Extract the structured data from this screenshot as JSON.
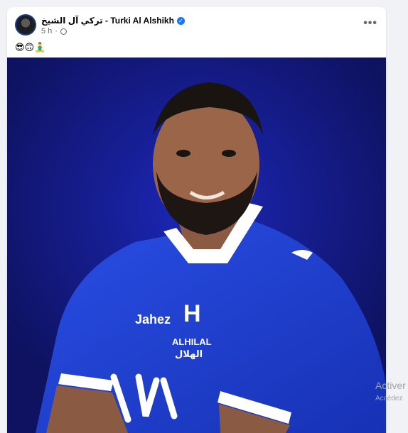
{
  "post": {
    "author_name": "تركي آل الشيخ - Turki Al Alshikh",
    "timestamp": "5 h",
    "caption": "😎🙃🧘‍♂️",
    "more_label": "•••"
  },
  "icons": {
    "verified": "verified-badge-icon",
    "audience": "globe-icon",
    "more": "more-options-icon"
  },
  "photo": {
    "jersey_brand": "Jahez",
    "club_name_en": "ALHILAL",
    "club_name_ar": "الهلال",
    "club_colors": {
      "blue": "#1f3fd6",
      "white": "#ffffff"
    }
  },
  "os_watermark": {
    "line1": "Activer",
    "line2": "Accédez"
  },
  "colors": {
    "page_bg": "#f0f2f5",
    "card_bg": "#ffffff",
    "photo_bg": "#151a78",
    "accent": "#1877f2"
  }
}
